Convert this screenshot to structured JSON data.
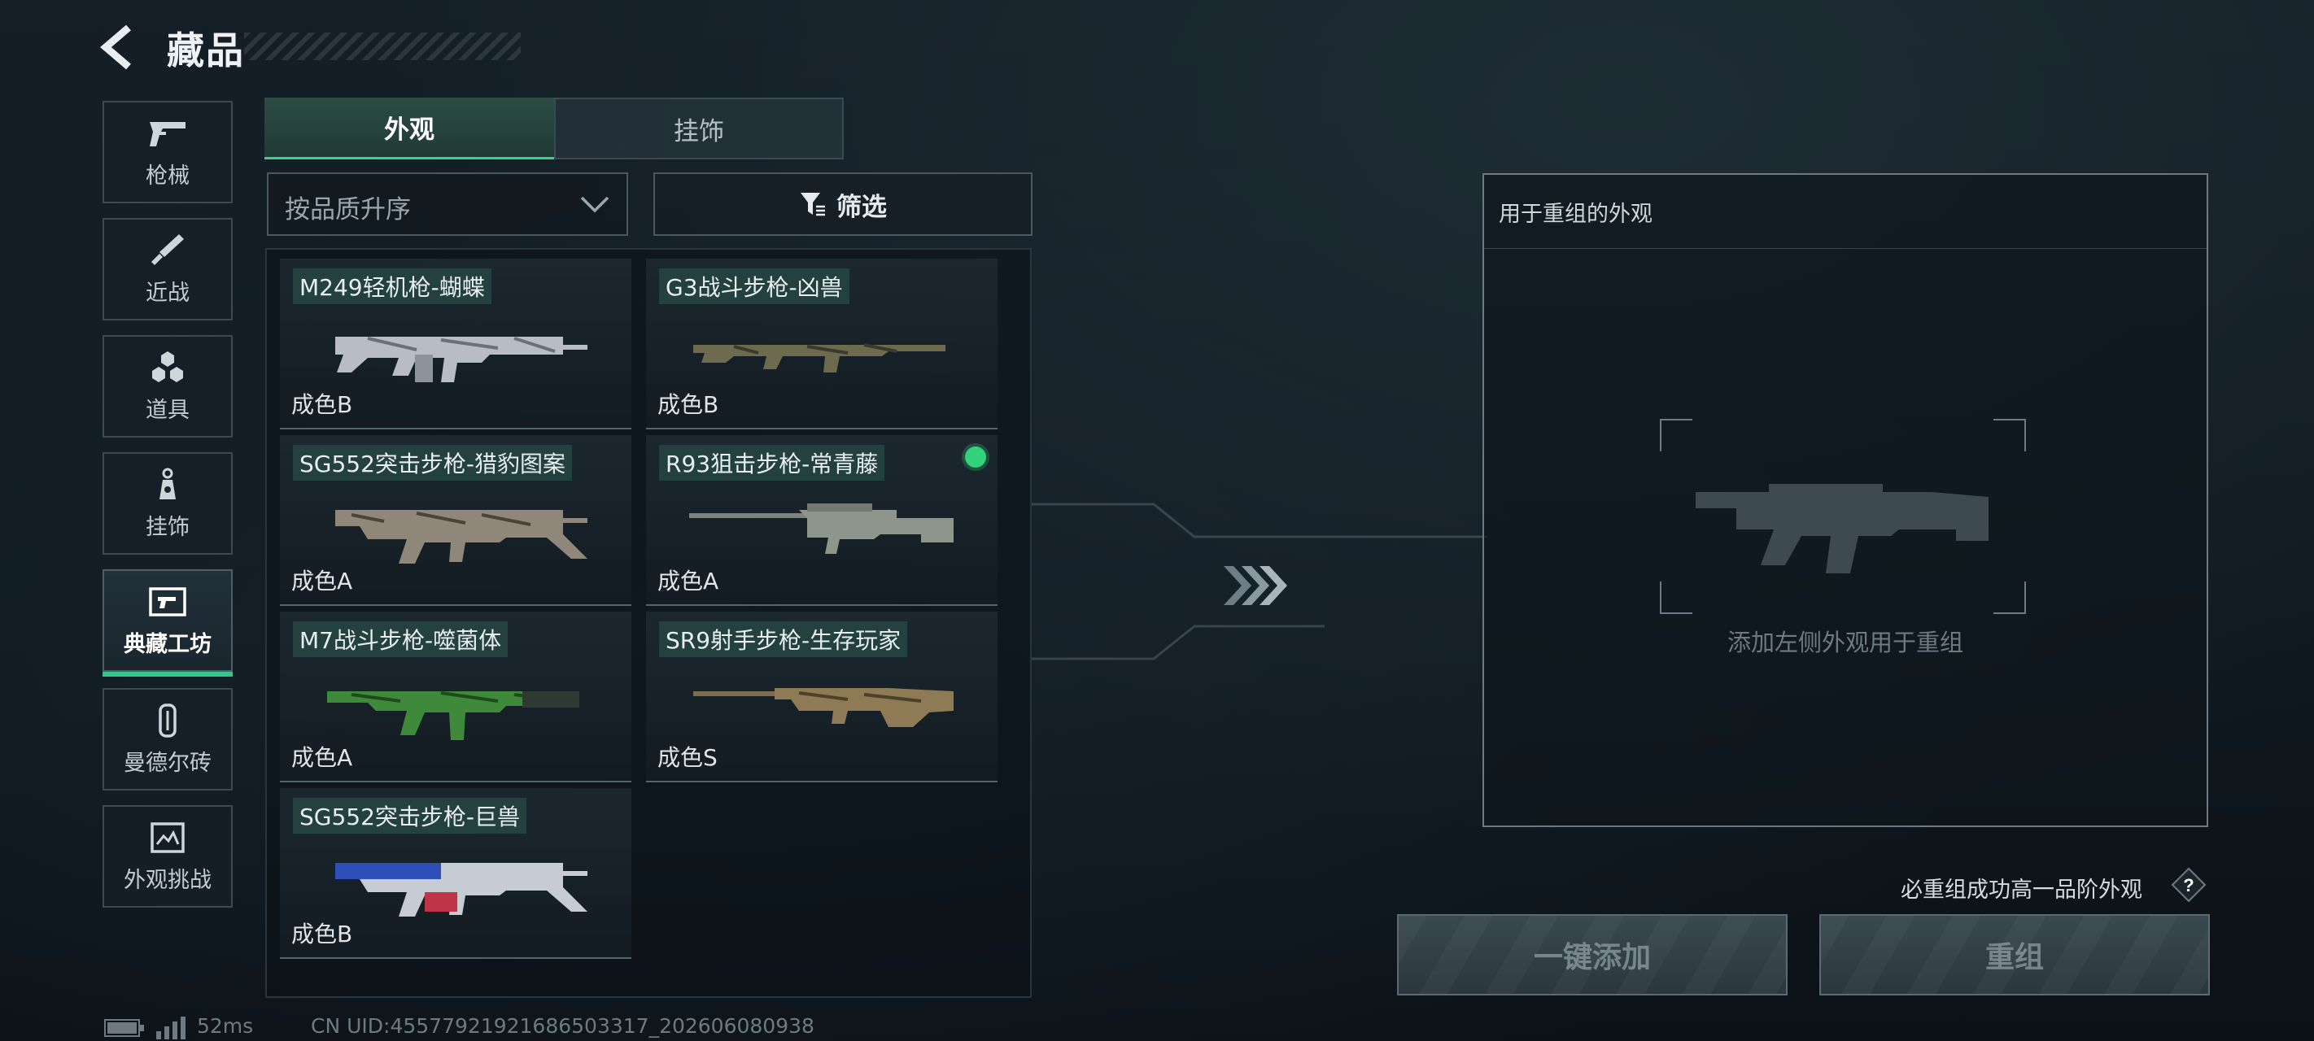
{
  "header": {
    "title": "藏品"
  },
  "sidebar": {
    "items": [
      {
        "label": "枪械",
        "icon": "pistol-icon",
        "active": false
      },
      {
        "label": "近战",
        "icon": "knife-icon",
        "active": false
      },
      {
        "label": "道具",
        "icon": "grenade-cluster-icon",
        "active": false
      },
      {
        "label": "挂饰",
        "icon": "keychain-icon",
        "active": false
      },
      {
        "label": "典藏工坊",
        "icon": "workshop-icon",
        "active": true
      },
      {
        "label": "曼德尔砖",
        "icon": "brick-icon",
        "active": false
      },
      {
        "label": "外观挑战",
        "icon": "challenge-icon",
        "active": false
      }
    ]
  },
  "tabs": [
    {
      "label": "外观",
      "active": true
    },
    {
      "label": "挂饰",
      "active": false
    }
  ],
  "sort": {
    "selected": "按品质升序"
  },
  "filter": {
    "label": "筛选"
  },
  "items": [
    {
      "name": "M249轻机枪-蝴蝶",
      "grade": "成色B",
      "selected": false
    },
    {
      "name": "G3战斗步枪-凶兽",
      "grade": "成色B",
      "selected": false
    },
    {
      "name": "SG552突击步枪-猎豹图案",
      "grade": "成色A",
      "selected": false
    },
    {
      "name": "R93狙击步枪-常青藤",
      "grade": "成色A",
      "selected": true
    },
    {
      "name": "M7战斗步枪-噬菌体",
      "grade": "成色A",
      "selected": false
    },
    {
      "name": "SR9射手步枪-生存玩家",
      "grade": "成色S",
      "selected": false
    },
    {
      "name": "SG552突击步枪-巨兽",
      "grade": "成色B",
      "selected": false
    }
  ],
  "recombine": {
    "panel_title": "用于重组的外观",
    "hint": "添加左侧外观用于重组",
    "rule": "必重组成功高一品阶外观",
    "help_label": "?",
    "add_all_label": "一键添加",
    "recombine_label": "重组"
  },
  "footer": {
    "ping": "52ms",
    "uid": "CN UID:45577921921686503317_202606080938"
  },
  "colors": {
    "accent": "#35c48a",
    "selected_dot": "#33d17a"
  }
}
